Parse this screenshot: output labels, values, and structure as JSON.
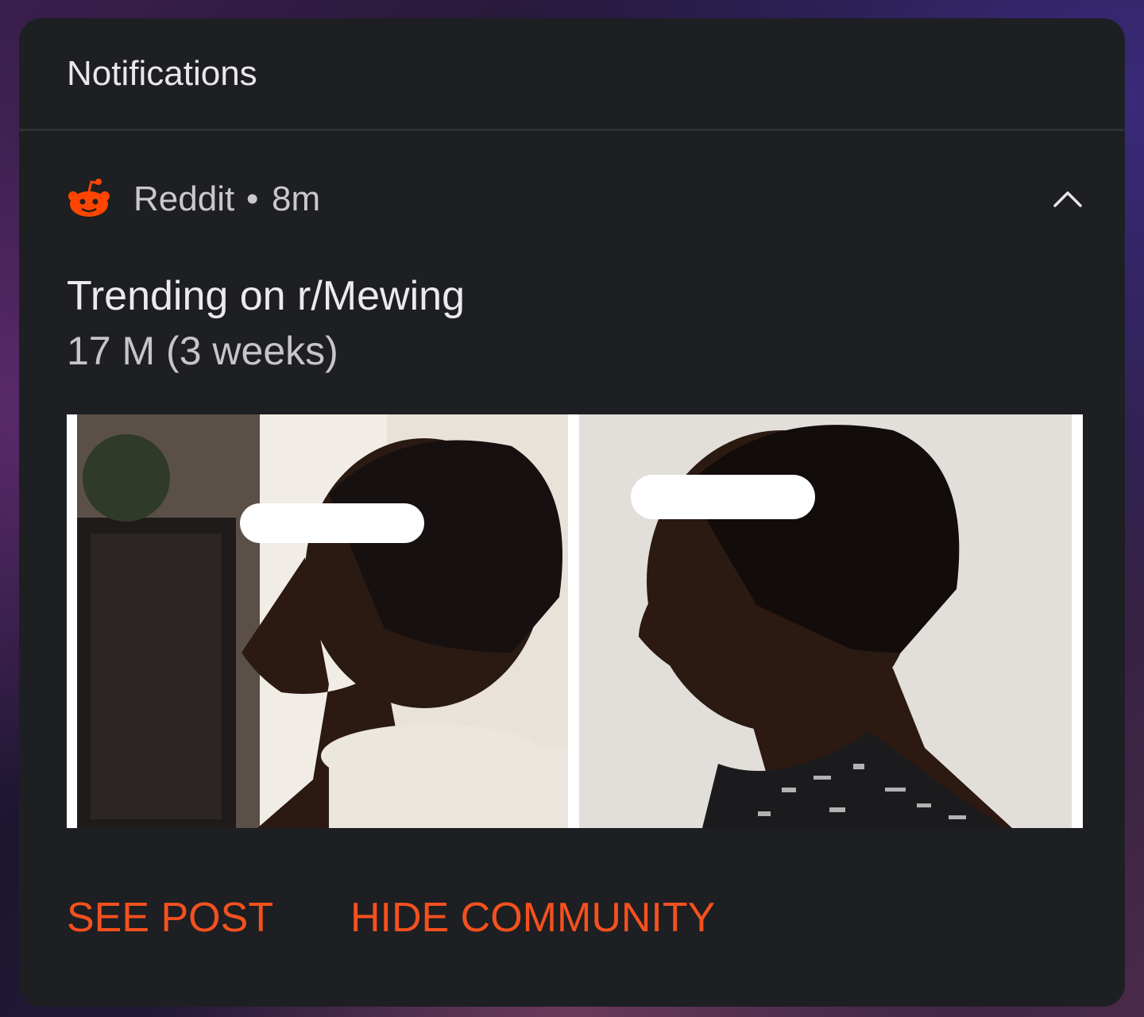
{
  "panel": {
    "title": "Notifications"
  },
  "notification": {
    "app_name": "Reddit",
    "separator": "•",
    "time_ago": "8m",
    "app_icon": "reddit-icon",
    "expand_icon": "chevron-up-icon",
    "title": "Trending on r/Mewing",
    "text": "17 M (3 weeks)",
    "image": "before-after-side-profile-photo",
    "actions": {
      "see_post": "SEE POST",
      "hide_community": "HIDE COMMUNITY"
    }
  },
  "colors": {
    "accent": "#f4511e",
    "panel_bg": "#1e1f22",
    "divider": "#2e3034"
  }
}
